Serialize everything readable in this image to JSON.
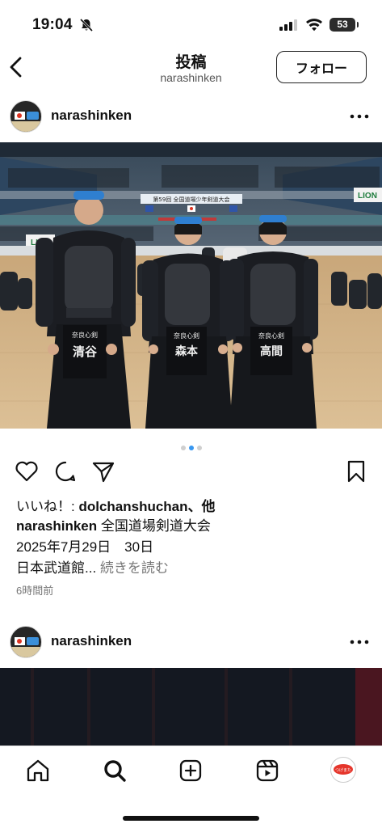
{
  "status": {
    "time": "19:04",
    "battery": "53"
  },
  "nav": {
    "title": "投稿",
    "subtitle": "narashinken",
    "follow_label": "フォロー"
  },
  "post": {
    "username": "narashinken",
    "banner": "第59回 全国道場少年剣道大会",
    "sponsor": "LION",
    "tags": {
      "left": {
        "dojo": "奈良心剣",
        "name": "清谷"
      },
      "center": {
        "dojo": "奈良心剣",
        "name": "森本"
      },
      "right": {
        "dojo": "奈良心剣",
        "name": "高間"
      }
    },
    "carousel": {
      "count": 3,
      "active": 2
    },
    "likes_prefix": "いいね！: ",
    "likes_user": "dolchanshuchan",
    "likes_suffix": "、他",
    "caption_user": "narashinken",
    "caption_line1": " 全国道場剣道大会",
    "caption_line2": "2025年7月29日　30日",
    "caption_line3": "日本武道館...",
    "more_label": " 続きを読む",
    "time_ago": "6時間前"
  },
  "next_post": {
    "username": "narashinken"
  },
  "tabbar": {
    "profile_avatar_text": "つげまた"
  },
  "icons": {
    "bell": "bell-slash-icon",
    "signal": "signal-icon",
    "wifi": "wifi-icon",
    "back": "chevron-left-icon",
    "more": "more-horizontal-icon",
    "like": "heart-icon",
    "comment": "comment-icon",
    "share": "send-icon",
    "save": "bookmark-icon",
    "home": "home-icon",
    "search": "search-icon",
    "create": "plus-square-icon",
    "reels": "reels-icon"
  },
  "colors": {
    "accent": "#3897f0",
    "text": "#111111",
    "muted": "#777777"
  }
}
